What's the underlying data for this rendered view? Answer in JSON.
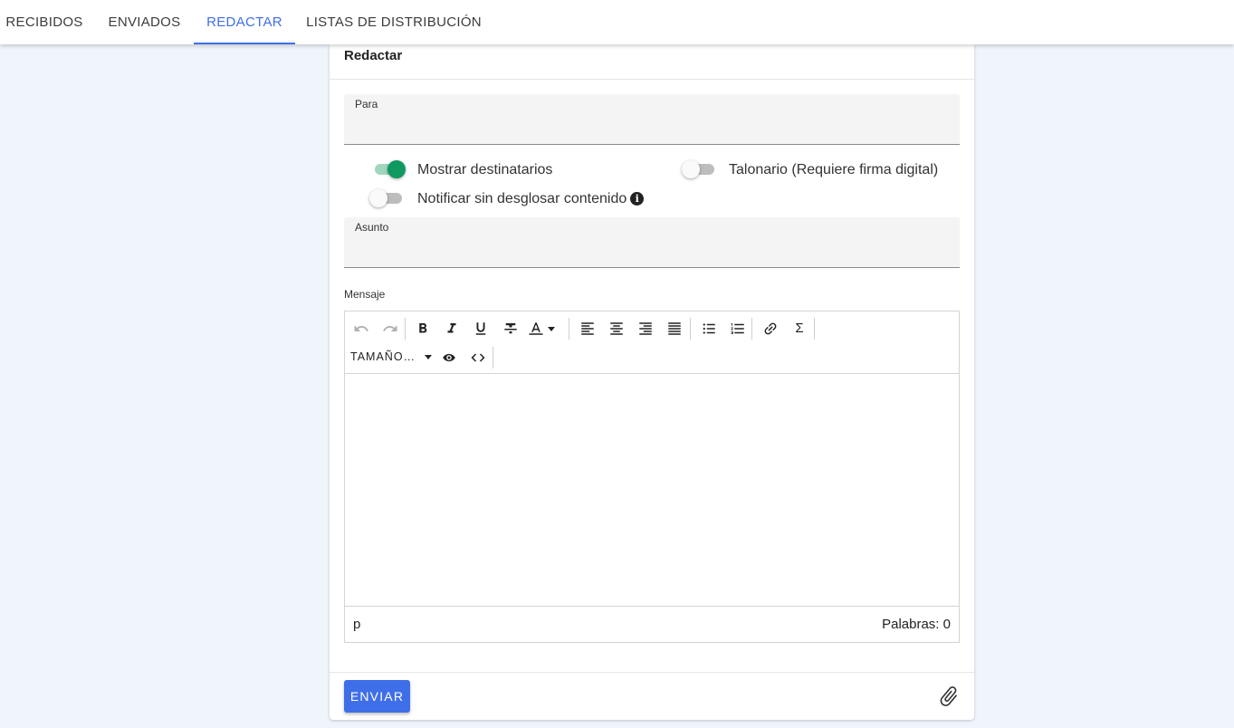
{
  "tabs": [
    {
      "label": "RECIBIDOS"
    },
    {
      "label": "ENVIADOS"
    },
    {
      "label": "REDACTAR"
    },
    {
      "label": "LISTAS DE DISTRIBUCIÓN"
    }
  ],
  "accent_color": "#3f6fe8",
  "switch_on_color": "#0f9960",
  "card": {
    "title": "Redactar",
    "to_label": "Para",
    "to_value": "",
    "subject_label": "Asunto",
    "subject_value": "",
    "message_label": "Mensaje"
  },
  "switches": {
    "show_recipients": {
      "label": "Mostrar destinatarios",
      "on": true
    },
    "talonario": {
      "label": "Talonario (Requiere firma digital)",
      "on": false
    },
    "notify": {
      "label": "Notificar sin desglosar contenido",
      "on": false,
      "info_icon": "i"
    }
  },
  "editor": {
    "toolbar_icons": [
      "undo-icon",
      "redo-icon",
      "bold-icon",
      "italic-icon",
      "underline-icon",
      "strikethrough-icon",
      "text-color-icon",
      "align-left-icon",
      "align-center-icon",
      "align-right-icon",
      "align-justify-icon",
      "bullet-list-icon",
      "numbered-list-icon",
      "link-icon",
      "sigma-icon",
      "preview-icon",
      "code-icon"
    ],
    "sigma_glyph": "Σ",
    "size_select": "TAMAÑO…",
    "status_path": "p",
    "word_count": "Palabras: 0"
  },
  "footer": {
    "send_label": "ENVIAR",
    "attach_icon": "paperclip-icon"
  }
}
